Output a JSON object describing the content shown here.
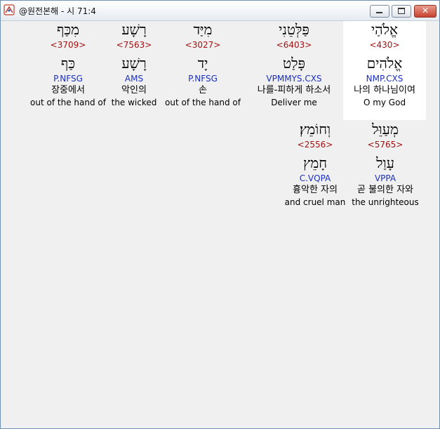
{
  "window": {
    "title": "@원전본해 - 시 71:4"
  },
  "controls": {
    "minimize_icon": "minimize-icon",
    "maximize_icon": "maximize-icon",
    "close_symbol": "✕"
  },
  "rows": [
    {
      "words": [
        {
          "hebrew": "אֱלֹהַי",
          "strong": "<430>",
          "lemma": "אֱלֹהִים",
          "morph": "NMP.CXS",
          "korean": "나의 하나님이여",
          "english": "O my God",
          "highlight": true
        },
        {
          "hebrew": "פַּלְּטֵנִי",
          "strong": "<6403>",
          "lemma": "פָּלַט",
          "morph": "VPMMYS.CXS",
          "korean": "나를-피하게 하소서",
          "english": "Deliver me",
          "highlight": false
        },
        {
          "hebrew": "מִיַּד",
          "strong": "<3027>",
          "lemma": "יָד",
          "morph": "P.NFSG",
          "korean": "손",
          "english": "out of the hand of",
          "highlight": false
        },
        {
          "hebrew": "רָשָׁע",
          "strong": "<7563>",
          "lemma": "רָשָׁע",
          "morph": "AMS",
          "korean": "악인의",
          "english": "the wicked",
          "highlight": false
        },
        {
          "hebrew": "מִכַּף",
          "strong": "<3709>",
          "lemma": "כַּף",
          "morph": "P.NFSG",
          "korean": "장중에서",
          "english": "out of the hand of",
          "highlight": false
        }
      ]
    },
    {
      "words": [
        {
          "hebrew": "מְעַוֵּל",
          "strong": "<5765>",
          "lemma": "עָוַל",
          "morph": "VPPA",
          "korean": "곧 불의한 자와",
          "english": "the unrighteous",
          "highlight": false
        },
        {
          "hebrew": "וְחוֹמֵץ׃",
          "strong": "<2556>",
          "lemma": "חָמֵץ",
          "morph": "C.VQPA",
          "korean": "흉악한 자의",
          "english": "and cruel man",
          "highlight": false
        }
      ]
    }
  ]
}
